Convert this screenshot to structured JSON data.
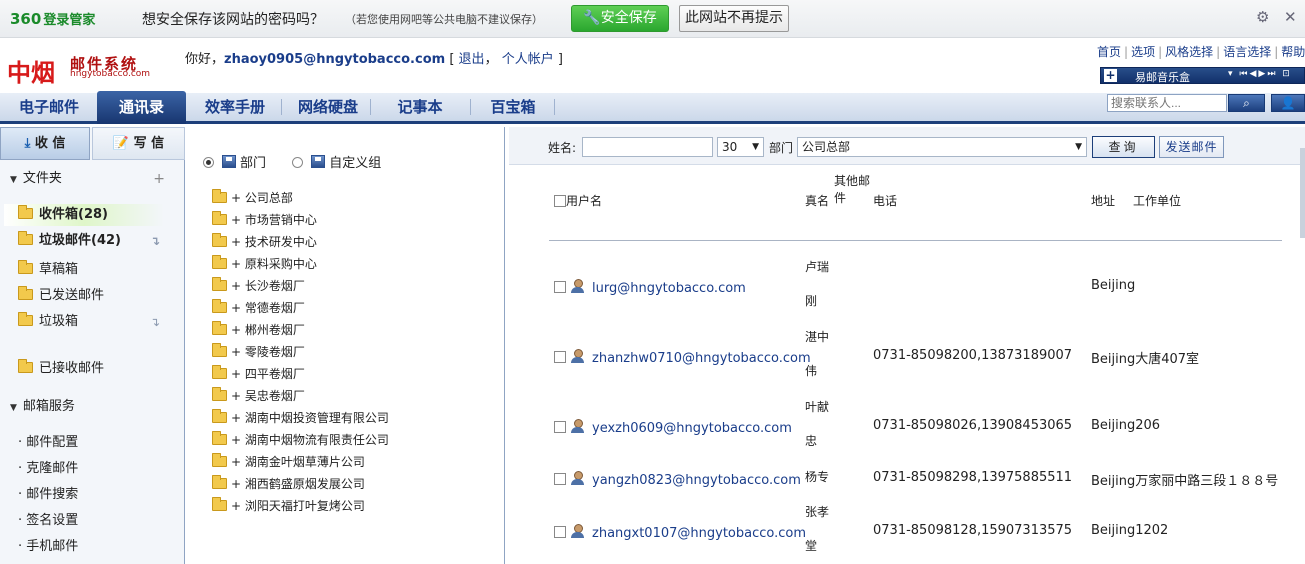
{
  "pw_bar": {
    "logo_num": "360",
    "logo_text": "登录管家",
    "question": "想安全保存该网站的密码吗？",
    "note": "（若您使用网吧等公共电脑不建议保存）",
    "save_label": "安全保存",
    "never_label": "此网站不再提示"
  },
  "header": {
    "logo_main": "中烟",
    "logo_sub": "邮件系统",
    "logo_domain": "hngytobacco.com",
    "greeting": "你好，",
    "user_email": "zhaoy0905@hngytobacco.com",
    "logout": "退出",
    "account": "个人帐户",
    "links": [
      "首页",
      "选项",
      "风格选择",
      "语言选择",
      "帮助"
    ],
    "music": "易邮音乐盒"
  },
  "nav": {
    "tabs": [
      "电子邮件",
      "通讯录",
      "效率手册",
      "网络硬盘",
      "记事本",
      "百宝箱"
    ],
    "active_index": 1,
    "search_placeholder": "搜索联系人..."
  },
  "sidebar": {
    "receive": "收 信",
    "write": "写 信",
    "folders_title": "文件夹",
    "folders": [
      {
        "label": "收件箱(28)",
        "bold": true
      },
      {
        "label": "垃圾邮件(42)",
        "bold": true
      },
      {
        "label": "草稿箱",
        "bold": false
      },
      {
        "label": "已发送邮件",
        "bold": false
      },
      {
        "label": "垃圾箱",
        "bold": false
      },
      {
        "label": "已接收邮件",
        "bold": false
      }
    ],
    "services_title": "邮箱服务",
    "services": [
      "· 邮件配置",
      "· 克隆邮件",
      "· 邮件搜索",
      "· 签名设置",
      "· 手机邮件"
    ]
  },
  "middle": {
    "radio_dept": "部门",
    "radio_custom": "自定义组",
    "departments": [
      "+ 公司总部",
      "+ 市场营销中心",
      "+ 技术研发中心",
      "+ 原料采购中心",
      "+ 长沙卷烟厂",
      "+ 常德卷烟厂",
      "+ 郴州卷烟厂",
      "+ 零陵卷烟厂",
      "+ 四平卷烟厂",
      "+ 吴忠卷烟厂",
      "+ 湖南中烟投资管理有限公司",
      "+ 湖南中烟物流有限责任公司",
      "+ 湖南金叶烟草薄片公司",
      "+ 湘西鹤盛原烟发展公司",
      "+ 浏阳天福打叶复烤公司"
    ]
  },
  "contacts": {
    "label_name": "姓名:",
    "page_size": "30",
    "label_dept": "部门",
    "dept_value": "公司总部",
    "query": "查询",
    "send": "发送邮件",
    "headers": {
      "username": "用户名",
      "realname": "真名",
      "other": "其他邮件",
      "phone": "电话",
      "address": "地址",
      "work": "工作单位"
    },
    "rows": [
      {
        "email": "lurg@hngytobacco.com",
        "name": "卢瑞刚",
        "phone": "",
        "address": "Beijing"
      },
      {
        "email": "zhanzhw0710@hngytobacco.com",
        "name": "湛中伟",
        "phone": "0731-85098200,13873189007",
        "address": "Beijing大唐407室"
      },
      {
        "email": "yexzh0609@hngytobacco.com",
        "name": "叶献忠",
        "phone": "0731-85098026,13908453065",
        "address": "Beijing206"
      },
      {
        "email": "yangzh0823@hngytobacco.com",
        "name": "杨专",
        "phone": "0731-85098298,13975885511",
        "address": "Beijing万家丽中路三段１８８号"
      },
      {
        "email": "zhangxt0107@hngytobacco.com",
        "name": "张孝堂",
        "phone": "0731-85098128,15907313575",
        "address": "Beijing1202"
      }
    ]
  },
  "colors": {
    "accent": "#1d3f7a",
    "brand_red": "#d71a1a",
    "save_green": "#2aa72f"
  }
}
